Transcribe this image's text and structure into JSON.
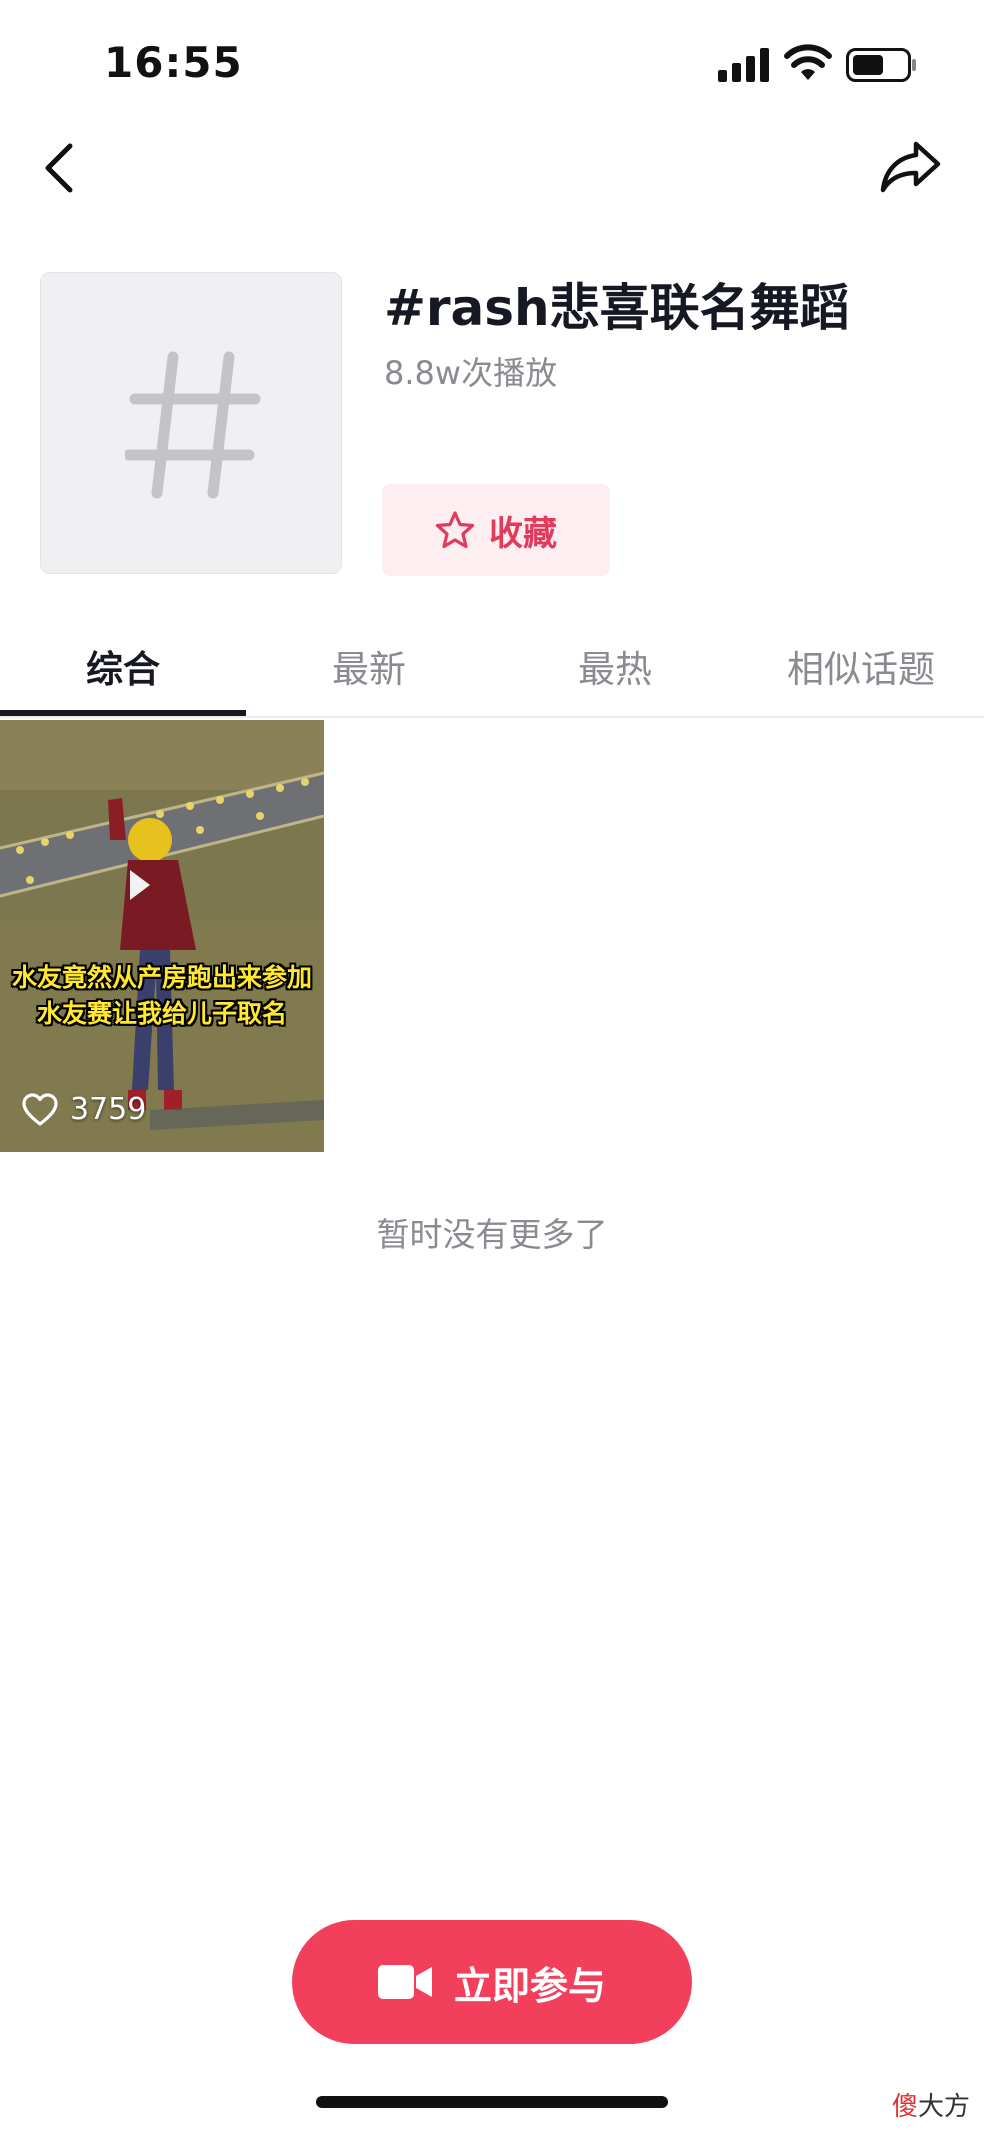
{
  "status_bar": {
    "time": "16:55",
    "icons": [
      "signal-icon",
      "wifi-icon",
      "battery-icon"
    ]
  },
  "nav": {
    "back_icon": "chevron-left-icon",
    "share_icon": "share-arrow-icon"
  },
  "topic": {
    "cover_icon": "hashtag-icon",
    "title": "#rash悲喜联名舞蹈",
    "play_count": "8.8w次播放",
    "favorite_label": "收藏",
    "favorite_icon": "star-icon"
  },
  "tabs": [
    {
      "label": "综合",
      "active": true
    },
    {
      "label": "最新",
      "active": false
    },
    {
      "label": "最热",
      "active": false
    },
    {
      "label": "相似话题",
      "active": false
    }
  ],
  "videos": [
    {
      "caption_line1": "水友竟然从产房跑出来参加",
      "caption_line2": "水友赛让我给儿子取名",
      "like_count": "3759",
      "like_icon": "heart-icon"
    }
  ],
  "no_more_text": "暂时没有更多了",
  "join_button": {
    "label": "立即参与",
    "icon": "video-camera-icon"
  },
  "watermark": {
    "first": "傻",
    "rest": "大方"
  },
  "colors": {
    "accent": "#f2405c",
    "favorite_bg": "#fdeef1",
    "favorite_text": "#e23a5b",
    "caption_yellow": "#ffe82e"
  }
}
